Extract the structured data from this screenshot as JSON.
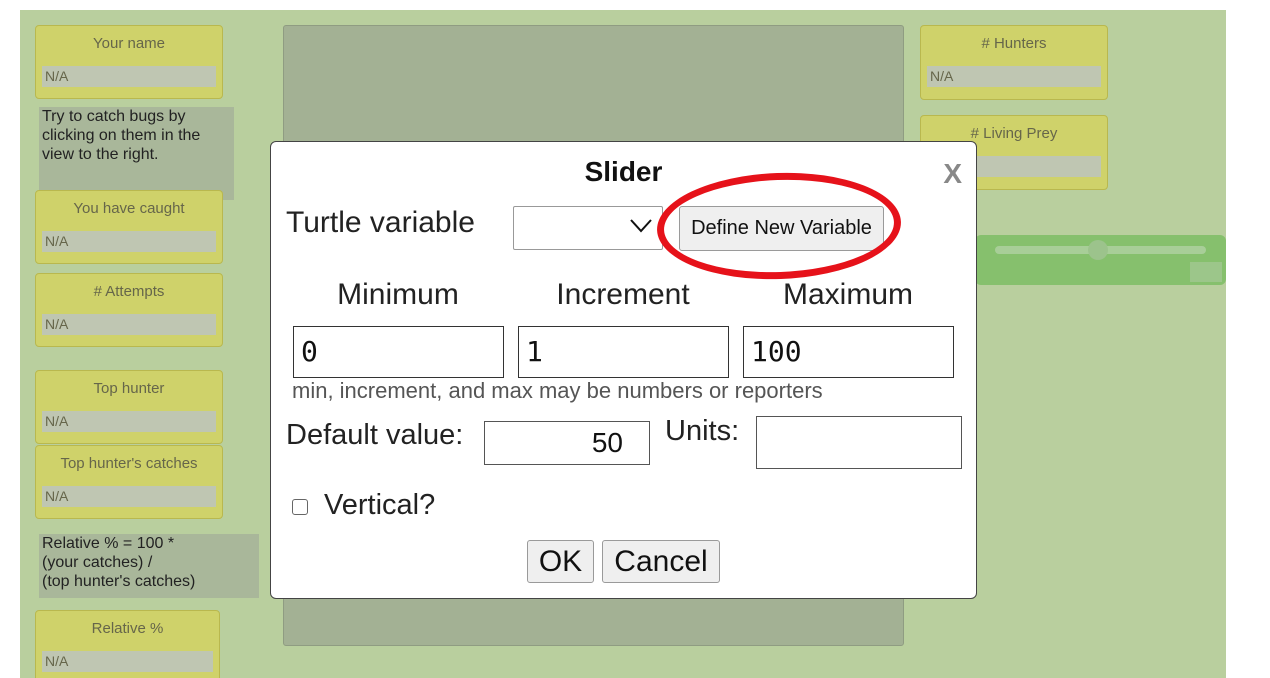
{
  "background_widgets": {
    "monitors": [
      {
        "label": "Your name",
        "value": "N/A"
      },
      {
        "label": "You have caught",
        "value": "N/A"
      },
      {
        "label": "# Attempts",
        "value": "N/A"
      },
      {
        "label": "Top hunter",
        "value": "N/A"
      },
      {
        "label": "Top hunter's catches",
        "value": "N/A"
      },
      {
        "label": "Relative %",
        "value": "N/A"
      },
      {
        "label": "# Hunters",
        "value": "N/A"
      },
      {
        "label": "# Living Prey",
        "value": ""
      }
    ],
    "notes": {
      "instructions": "Try to catch bugs by clicking on them in the view to the right.",
      "relative_formula": [
        "Relative % = 100 *",
        "(your catches) /",
        "(top hunter's catches)"
      ]
    }
  },
  "dialog": {
    "title": "Slider",
    "close_label": "X",
    "turtle_variable_label": "Turtle variable",
    "turtle_variable_value": "",
    "define_new_variable_label": "Define New Variable",
    "minimum_label": "Minimum",
    "increment_label": "Increment",
    "maximum_label": "Maximum",
    "minimum_value": "0",
    "increment_value": "1",
    "maximum_value": "100",
    "hint": "min, increment, and max may be numbers or reporters",
    "default_value_label": "Default value:",
    "default_value": "50",
    "units_label": "Units:",
    "units_value": "",
    "vertical_label": "Vertical?",
    "vertical_checked": false,
    "ok_label": "OK",
    "cancel_label": "Cancel"
  },
  "annotation": {
    "color": "#e6121a",
    "shape": "ellipse",
    "target": "define-new-variable-button"
  }
}
